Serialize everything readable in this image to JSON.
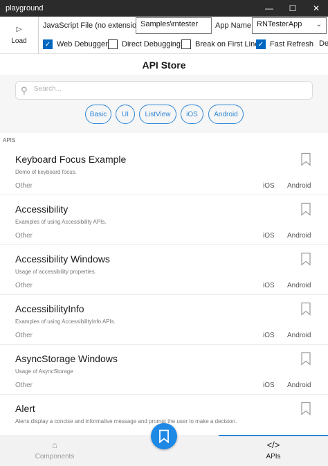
{
  "window": {
    "title": "playground",
    "controls": {
      "minimize": "—",
      "maximize": "☐",
      "close": "✕"
    }
  },
  "toolbar": {
    "load_label": "Load",
    "load_icon": "▷",
    "js_file_label": "JavaScript File (no extension):",
    "js_file_value": "Samples\\rntester",
    "app_name_label": "App Name:",
    "app_name_value": "RNTesterApp",
    "checkboxes": [
      {
        "label": "Web Debugger",
        "checked": true
      },
      {
        "label": "Direct Debugging",
        "checked": false
      },
      {
        "label": "Break on First Line",
        "checked": false
      },
      {
        "label": "Fast Refresh",
        "checked": true
      },
      {
        "label": "De",
        "checked": false
      }
    ]
  },
  "page": {
    "title": "API Store",
    "search_placeholder": "Search...",
    "chips": [
      "Basic",
      "UI",
      "ListView",
      "iOS",
      "Android"
    ],
    "section_label": "APIS"
  },
  "list": [
    {
      "name": "Keyboard Focus Example",
      "description": "Demo of keyboard focus.",
      "category": "Other",
      "platforms": [
        "iOS",
        "Android"
      ]
    },
    {
      "name": "Accessibility",
      "description": "Examples of using Accessibility APIs.",
      "category": "Other",
      "platforms": [
        "iOS",
        "Android"
      ]
    },
    {
      "name": "Accessibility Windows",
      "description": "Usage of accessibility properties.",
      "category": "Other",
      "platforms": [
        "iOS",
        "Android"
      ]
    },
    {
      "name": "AccessibilityInfo",
      "description": "Examples of using AccessibilityInfo APIs.",
      "category": "Other",
      "platforms": [
        "iOS",
        "Android"
      ]
    },
    {
      "name": "AsyncStorage Windows",
      "description": "Usage of AsyncStorage",
      "category": "Other",
      "platforms": [
        "iOS",
        "Android"
      ]
    },
    {
      "name": "Alert",
      "description": "Alerts display a concise and informative message and prompt the user to make a decision.",
      "category": "",
      "platforms": []
    }
  ],
  "bottom_nav": {
    "components_label": "Components",
    "apis_label": "APIs",
    "components_icon": "⌂",
    "apis_icon": "</>"
  },
  "colors": {
    "accent": "#2f86d6",
    "fab": "#1e88e5",
    "titlebar": "#2b2b2b"
  }
}
